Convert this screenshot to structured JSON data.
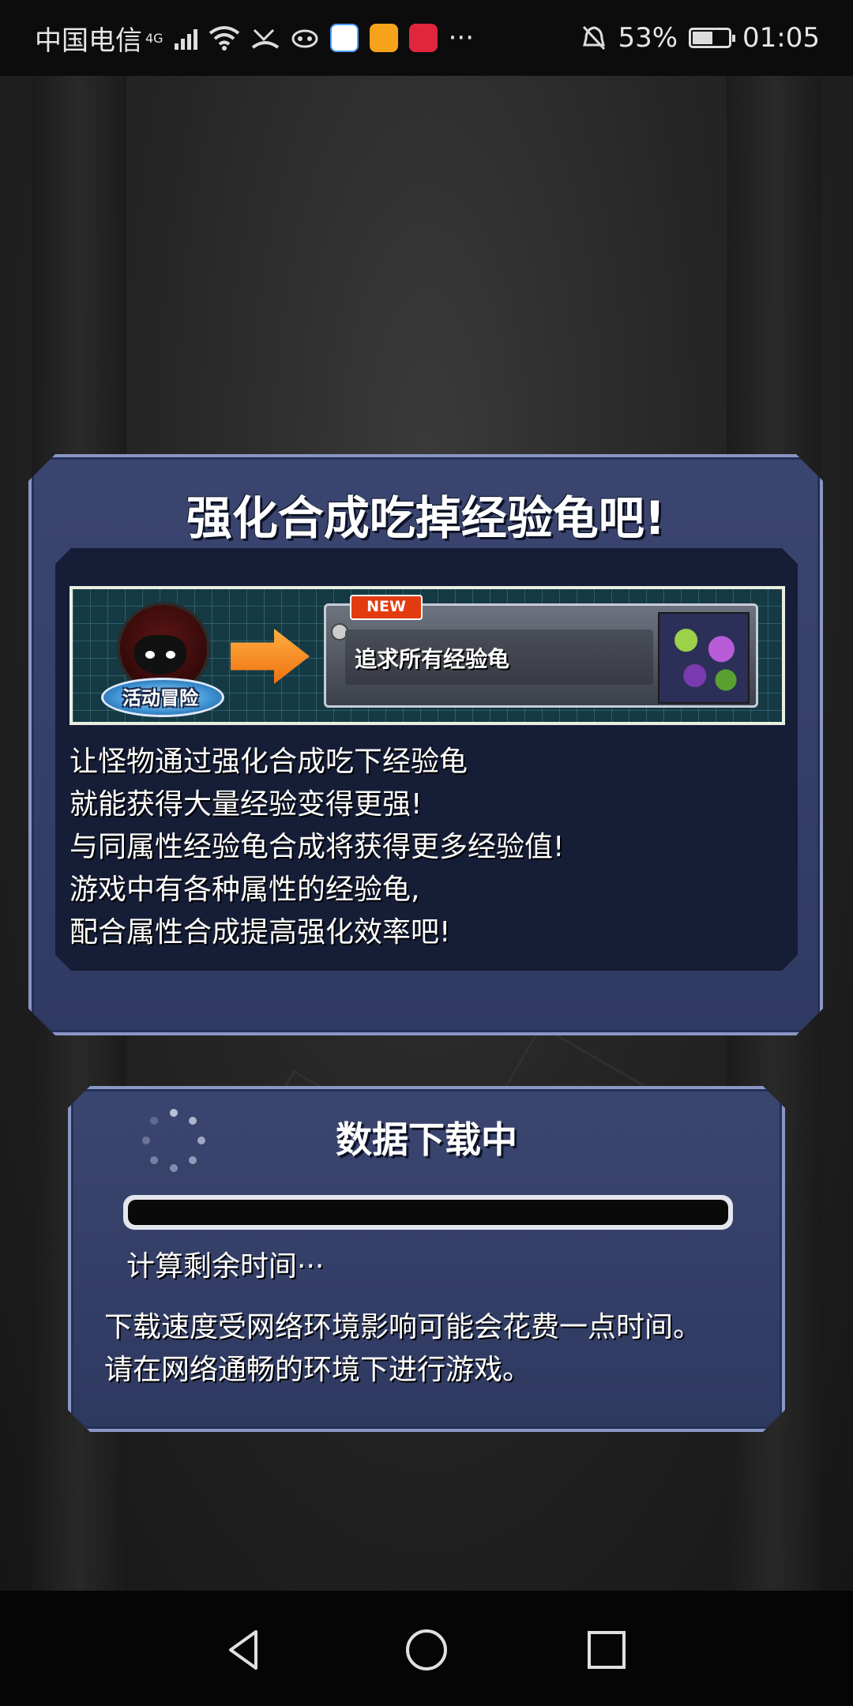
{
  "status_bar": {
    "carrier": "中国电信",
    "network": "4G",
    "battery_percent": "53%",
    "time": "01:05",
    "more": "···",
    "icons": [
      "signal-icon",
      "wifi-icon",
      "missed-call-icon",
      "sim-icon",
      "app-badge-icon",
      "wallet-icon",
      "huawei-icon",
      "mute-bell-icon",
      "battery-icon"
    ]
  },
  "tip_panel": {
    "title": "强化合成吃掉经验龟吧!",
    "banner": {
      "stage_label": "活动冒险",
      "new_badge": "NEW",
      "quest_name": "追求所有经验龟"
    },
    "lines": [
      "让怪物通过强化合成吃下经验龟",
      "就能获得大量经验变得更强!",
      "与同属性经验龟合成将获得更多经验值!",
      "游戏中有各种属性的经验龟,",
      "配合属性合成提高强化效率吧!"
    ]
  },
  "download_panel": {
    "title": "数据下载中",
    "progress": 0,
    "remaining": "计算剩余时间···",
    "note_lines": [
      "下载速度受网络环境影响可能会花费一点时间。",
      "请在网络通畅的环境下进行游戏。"
    ]
  },
  "nav_bar": {
    "buttons": [
      "back-icon",
      "home-icon",
      "recent-apps-icon"
    ]
  },
  "colors": {
    "panel": "#34406a",
    "panel_border": "#8a96c4",
    "new_badge": "#e23b10",
    "arrow": "#f08a20"
  }
}
